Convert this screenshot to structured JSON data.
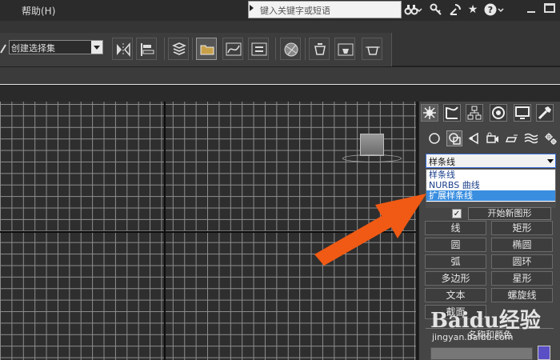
{
  "menubar": {
    "help_label": "帮助(H)",
    "search_placeholder": "键入关键字或短语",
    "icons": [
      "binoculars-icon",
      "key-icon",
      "satellite-icon",
      "star-icon",
      "help-icon"
    ]
  },
  "toolbar": {
    "selection_set_value": "创建选择集"
  },
  "command_panel": {
    "tabs": [
      "create-tab",
      "modify-tab",
      "hierarchy-tab",
      "motion-tab",
      "display-tab",
      "utilities-tab"
    ],
    "category_selected": "样条线",
    "category_options": [
      "样条线",
      "NURBS 曲线",
      "扩展样条线"
    ],
    "category_highlighted_index": 2,
    "start_new_shape": "开始新图形",
    "start_new_shape_checked": true,
    "object_types": [
      "线",
      "矩形",
      "圆",
      "椭圆",
      "弧",
      "圆环",
      "多边形",
      "星形",
      "文本",
      "螺旋线",
      "截面"
    ],
    "name_and_color": "名称和颜色",
    "swatch_color": "#5a4fc4"
  },
  "watermark": {
    "logo": "Baidu经验",
    "url": "jingyan.baidu.com"
  },
  "colors": {
    "accent_arrow": "#f05a14",
    "list_highlight": "#3a8ee0"
  }
}
